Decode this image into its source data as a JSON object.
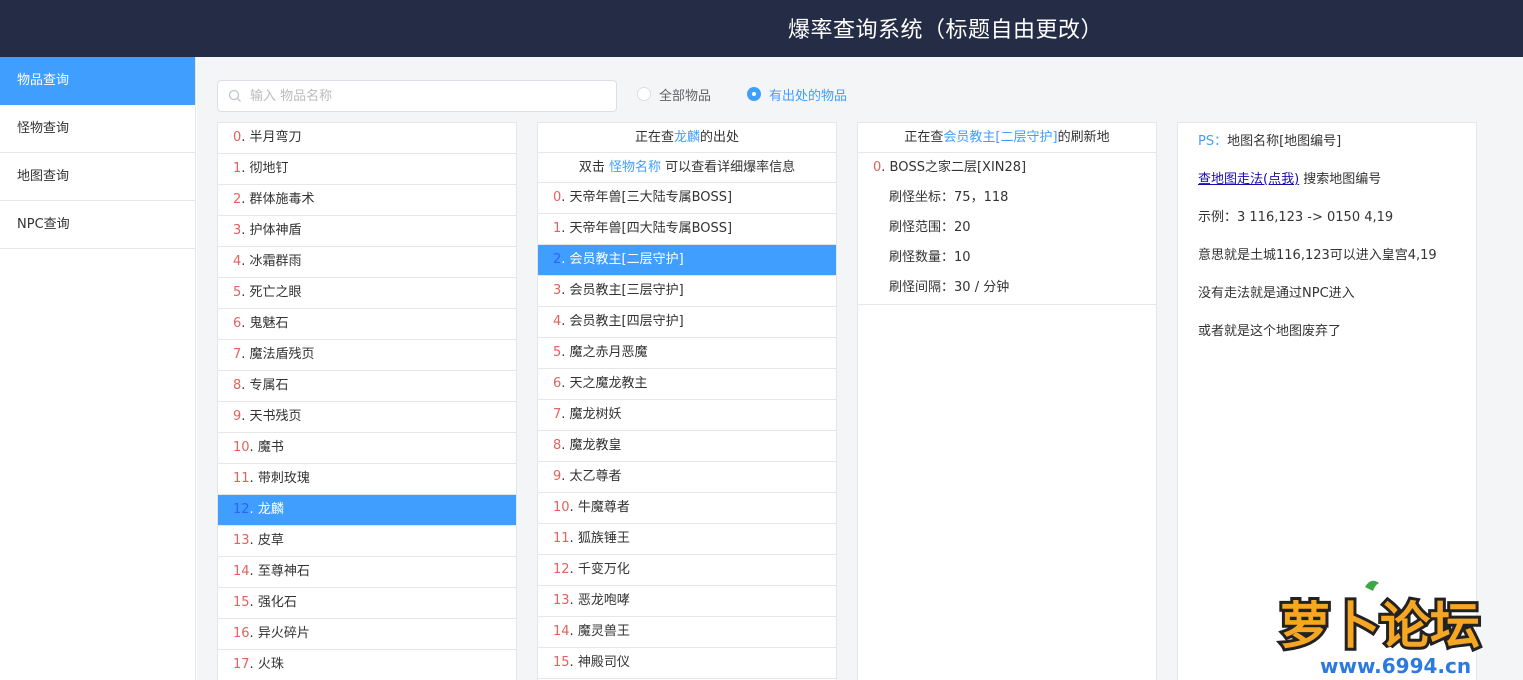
{
  "header": {
    "title": "爆率查询系统（标题自由更改）"
  },
  "sidebar": {
    "items": [
      {
        "label": "物品查询",
        "active": true
      },
      {
        "label": "怪物查询",
        "active": false
      },
      {
        "label": "地图查询",
        "active": false
      },
      {
        "label": "NPC查询",
        "active": false
      }
    ]
  },
  "search": {
    "placeholder": "输入 物品名称",
    "value": "",
    "icon": "search-icon"
  },
  "filters": {
    "options": [
      {
        "label": "全部物品",
        "checked": false
      },
      {
        "label": "有出处的物品",
        "checked": true
      }
    ]
  },
  "items": {
    "selected_index": 12,
    "list": [
      {
        "num": "0",
        "name": "半月弯刀"
      },
      {
        "num": "1",
        "name": "彻地钉"
      },
      {
        "num": "2",
        "name": "群体施毒术"
      },
      {
        "num": "3",
        "name": "护体神盾"
      },
      {
        "num": "4",
        "name": "冰霜群雨"
      },
      {
        "num": "5",
        "name": "死亡之眼"
      },
      {
        "num": "6",
        "name": "鬼魅石"
      },
      {
        "num": "7",
        "name": "魔法盾残页"
      },
      {
        "num": "8",
        "name": "专属石"
      },
      {
        "num": "9",
        "name": "天书残页"
      },
      {
        "num": "10",
        "name": "魔书"
      },
      {
        "num": "11",
        "name": "带刺玫瑰"
      },
      {
        "num": "12",
        "name": "龙麟"
      },
      {
        "num": "13",
        "name": "皮草"
      },
      {
        "num": "14",
        "name": "至尊神石"
      },
      {
        "num": "15",
        "name": "强化石"
      },
      {
        "num": "16",
        "name": "异火碎片"
      },
      {
        "num": "17",
        "name": "火珠"
      }
    ]
  },
  "source_panel": {
    "head_prefix": "正在查",
    "head_item": "龙麟",
    "head_suffix": "的出处",
    "hint_prefix": "双击 ",
    "hint_link": "怪物名称",
    "hint_suffix": " 可以查看详细爆率信息",
    "selected_index": 2,
    "monsters": [
      {
        "num": "0",
        "name": "天帝年兽[三大陆专属BOSS]"
      },
      {
        "num": "1",
        "name": "天帝年兽[四大陆专属BOSS]"
      },
      {
        "num": "2",
        "name": "会员教主[二层守护]"
      },
      {
        "num": "3",
        "name": "会员教主[三层守护]"
      },
      {
        "num": "4",
        "name": "会员教主[四层守护]"
      },
      {
        "num": "5",
        "name": "魔之赤月恶魔"
      },
      {
        "num": "6",
        "name": "天之魔龙教主"
      },
      {
        "num": "7",
        "name": "魔龙树妖"
      },
      {
        "num": "8",
        "name": "魔龙教皇"
      },
      {
        "num": "9",
        "name": "太乙尊者"
      },
      {
        "num": "10",
        "name": "牛魔尊者"
      },
      {
        "num": "11",
        "name": "狐族锤王"
      },
      {
        "num": "12",
        "name": "千变万化"
      },
      {
        "num": "13",
        "name": "恶龙咆哮"
      },
      {
        "num": "14",
        "name": "魔灵兽王"
      },
      {
        "num": "15",
        "name": "神殿司仪"
      }
    ]
  },
  "refresh_panel": {
    "head_prefix": "正在查",
    "head_monster": "会员教主[二层守护]",
    "head_suffix": "的刷新地",
    "map_num": "0",
    "map_name": "BOSS之家二层[XIN28]",
    "details": [
      {
        "label": "刷怪坐标",
        "value": "75，118"
      },
      {
        "label": "刷怪范围",
        "value": "20"
      },
      {
        "label": "刷怪数量",
        "value": "10"
      },
      {
        "label": "刷怪间隔",
        "value": "30 / 分钟"
      }
    ]
  },
  "notes": {
    "ps_label": "PS：",
    "ps_text": "地图名称[地图编号]",
    "link_prefix": "查地图",
    "link_text": "走法(点我)",
    "link_suffix": " 搜索地图编号",
    "example": "示例：3 116,123 -> 0150 4,19",
    "meaning": "意思就是土城116,123可以进入皇宫4,19",
    "no_path": "没有走法就是通过NPC进入",
    "abandoned": "或者就是这个地图废弃了"
  },
  "watermark": {
    "text": "萝卜论坛",
    "url": "www.6994.cn"
  },
  "colors": {
    "header_bg": "#252c45",
    "accent": "#409eff",
    "number": "#e2625d"
  }
}
